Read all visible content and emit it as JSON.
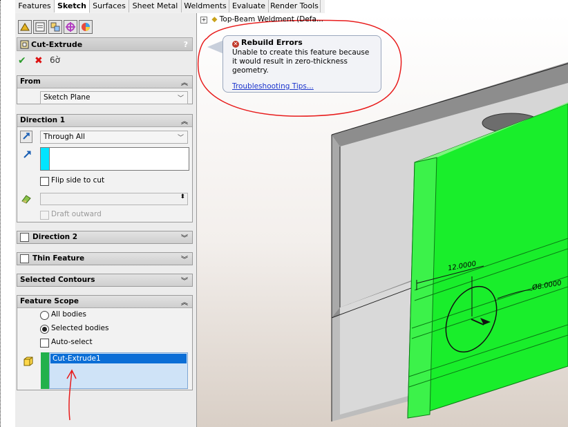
{
  "tabs": [
    "Features",
    "Sketch",
    "Surfaces",
    "Sheet Metal",
    "Weldments",
    "Evaluate",
    "Render Tools"
  ],
  "active_tab": "Sketch",
  "property_manager": {
    "title": "Cut-Extrude",
    "help": "?",
    "from": {
      "header": "From",
      "value": "Sketch Plane"
    },
    "direction1": {
      "header": "Direction 1",
      "end_condition": "Through All",
      "flip_label": "Flip side to cut",
      "draft_label": "Draft outward"
    },
    "direction2": {
      "header": "Direction 2"
    },
    "thin_feature": {
      "header": "Thin Feature"
    },
    "selected_contours": {
      "header": "Selected Contours"
    },
    "feature_scope": {
      "header": "Feature Scope",
      "all_bodies": "All bodies",
      "selected_bodies": "Selected bodies",
      "auto_select": "Auto-select",
      "bodies": [
        "Cut-Extrude1"
      ]
    }
  },
  "tree": {
    "node": "Top-Beam Weldment  (Defa..."
  },
  "rebuild_error": {
    "title": "Rebuild Errors",
    "message": "Unable to create this feature because it would result in zero-thickness geometry.",
    "link": "Troubleshooting Tips..."
  },
  "dimensions": {
    "linear": "12.0000",
    "diameter": "Ø8.0000"
  },
  "colors": {
    "green_plate": "#19ee2b",
    "selection": "#0b6ed6",
    "annotation": "#e81b1b",
    "cyan_swatch": "#00e5ff"
  }
}
